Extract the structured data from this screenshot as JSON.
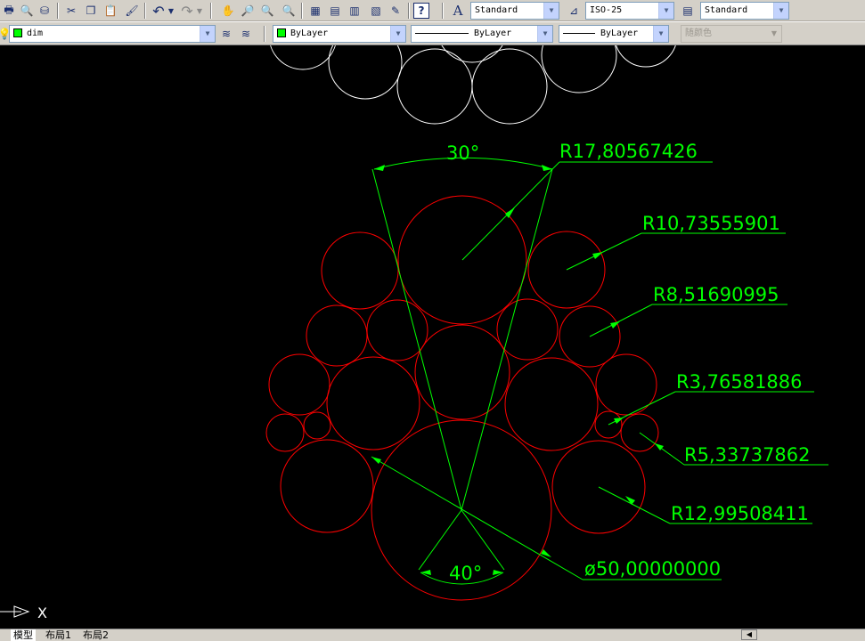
{
  "toolbar_standard": {
    "text_style": "Standard",
    "dim_style": "ISO-25",
    "table_style": "Standard"
  },
  "toolbar_layers": {
    "layer": "dim",
    "color": "ByLayer",
    "linetype": "ByLayer",
    "lineweight": "ByLayer",
    "plot_style": "随颜色"
  },
  "colors": {
    "accent_green": "#00ff00",
    "circle_red": "#ff0000",
    "white": "#ffffff"
  },
  "drawing": {
    "angle_top": "30°",
    "angle_bottom": "40°",
    "dims": {
      "r17": "R17,80567426",
      "r10": "R10,73555901",
      "r8": "R8,51690995",
      "r3": "R3,76581886",
      "r5": "R5,33737862",
      "r12": "R12,99508411",
      "dia50": "ø50,00000000"
    }
  },
  "ucs": {
    "x_label": "X"
  },
  "layout_tabs": [
    "模型",
    "布局1",
    "布局2"
  ]
}
